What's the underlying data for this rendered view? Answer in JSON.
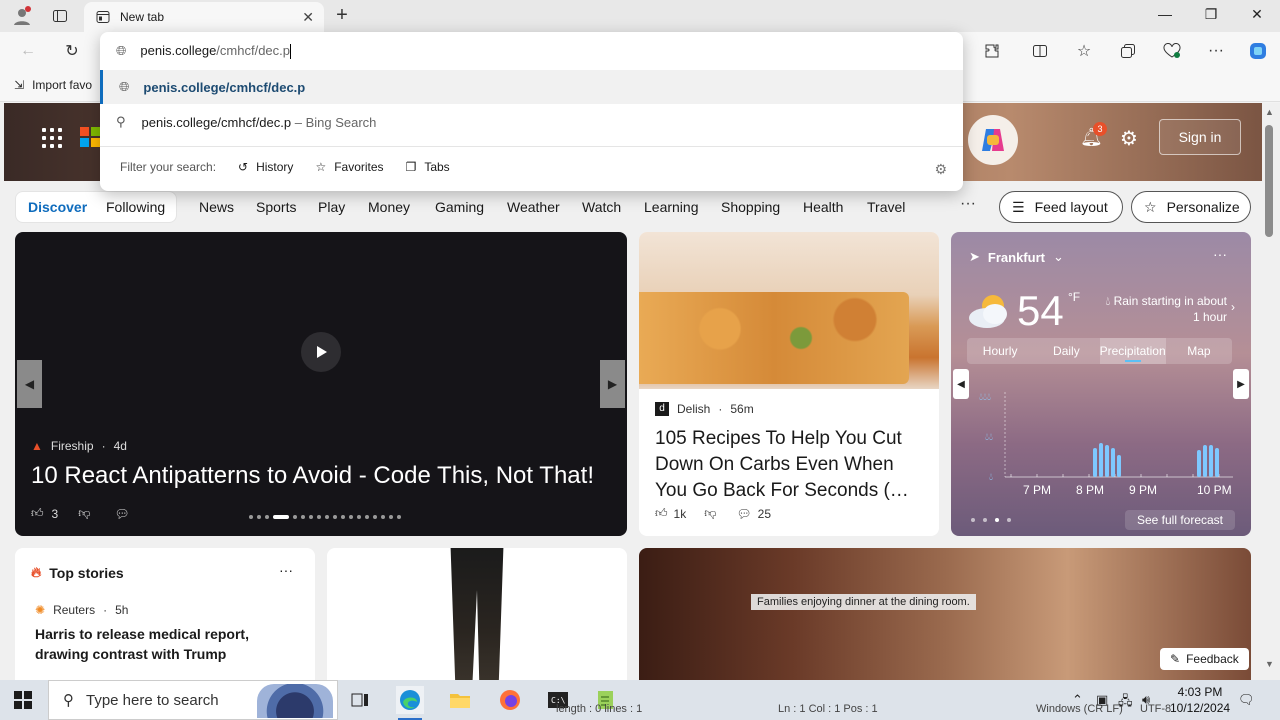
{
  "browser": {
    "tab_title": "New tab",
    "favorites_import": "Import favo",
    "omnibox": {
      "host": "penis.college",
      "path": "/cmhcf/dec.p",
      "suggestion_url": "penis.college/cmhcf/dec.p",
      "search_query": "penis.college/cmhcf/dec.p",
      "search_suffix": "– Bing Search",
      "filter_label": "Filter your search:",
      "filters": [
        "History",
        "Favorites",
        "Tabs"
      ]
    }
  },
  "header": {
    "signin": "Sign in",
    "notifications_count": "3"
  },
  "nav": {
    "items": [
      "Discover",
      "Following",
      "News",
      "Sports",
      "Play",
      "Money",
      "Gaming",
      "Weather",
      "Watch",
      "Learning",
      "Shopping",
      "Health",
      "Travel"
    ],
    "more": "···",
    "feed_layout": "Feed layout",
    "personalize": "Personalize"
  },
  "carousel": {
    "source": "Fireship",
    "age": "4d",
    "title": "10 React Antipatterns to Avoid - Code This, Not That!",
    "likes": "3"
  },
  "food_card": {
    "source": "Delish",
    "age": "56m",
    "title": "105 Recipes To Help You Cut Down On Carbs Even When You Go Back For Seconds (…",
    "likes": "1k",
    "comments": "25"
  },
  "weather": {
    "location": "Frankfurt",
    "temp": "54",
    "unit": "°F",
    "condition": "Rain starting in about 1 hour",
    "tabs": [
      "Hourly",
      "Daily",
      "Precipitation",
      "Map"
    ],
    "active_tab": "Precipitation",
    "times": [
      "7 PM",
      "8 PM",
      "9 PM",
      "10 PM"
    ],
    "see_full": "See full forecast",
    "more": "···"
  },
  "top_stories": {
    "heading": "Top stories",
    "more": "···",
    "source": "Reuters",
    "age": "5h",
    "title": "Harris to release medical report, drawing contrast with Trump"
  },
  "dinner_card": {
    "caption": "Families enjoying dinner at the dining room.",
    "feedback": "Feedback"
  },
  "taskbar": {
    "search_placeholder": "Type here to search",
    "time": "4:03 PM",
    "date": "10/12/2024"
  },
  "background_window_text": {
    "length": "length : 0    lines : 1",
    "position": "Ln : 1    Col : 1    Pos : 1",
    "eol": "Windows (CR LF)",
    "encoding": "UTF-8"
  }
}
